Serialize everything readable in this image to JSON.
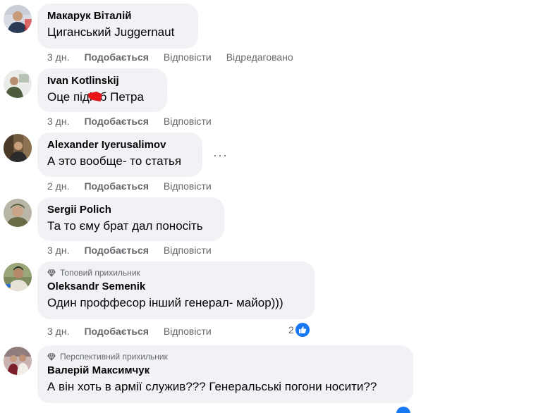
{
  "comments": [
    {
      "author": "Макарук Віталій",
      "text": "Циганський Juggernaut",
      "time": "3 дн.",
      "like": "Подобається",
      "reply": "Відповісти",
      "edited": "Відредаговано"
    },
    {
      "author": "Ivan Kotlinskij",
      "text_before": "Оце піді",
      "text_after": "б Петра",
      "time": "3 дн.",
      "like": "Подобається",
      "reply": "Відповісти"
    },
    {
      "author": "Alexander Iyerusalimov",
      "text": "А это вообще- то статья",
      "time": "2 дн.",
      "like": "Подобається",
      "reply": "Відповісти",
      "more": "···"
    },
    {
      "author": "Sergii Polich",
      "text": "Та то єму брат дал поносіть",
      "time": "3 дн.",
      "like": "Подобається",
      "reply": "Відповісти"
    },
    {
      "badge": "Топовий прихильник",
      "author": "Oleksandr Semenik",
      "text": "Один проффесор інший генерал- майор)))",
      "time": "3 дн.",
      "like": "Подобається",
      "reply": "Відповісти",
      "reactions": "2"
    },
    {
      "badge": "Перспективний прихильник",
      "author": "Валерій Максимчук",
      "text": "А він хоть в армії служив??? Генеральські погони носити??"
    }
  ],
  "icons": {
    "badge": "diamond-icon",
    "reaction": "thumbs-up-icon",
    "more": "more-options-icon"
  },
  "colors": {
    "bubble": "#f0f2f5",
    "meta_text": "#65676b",
    "like_blue": "#1877f2"
  }
}
